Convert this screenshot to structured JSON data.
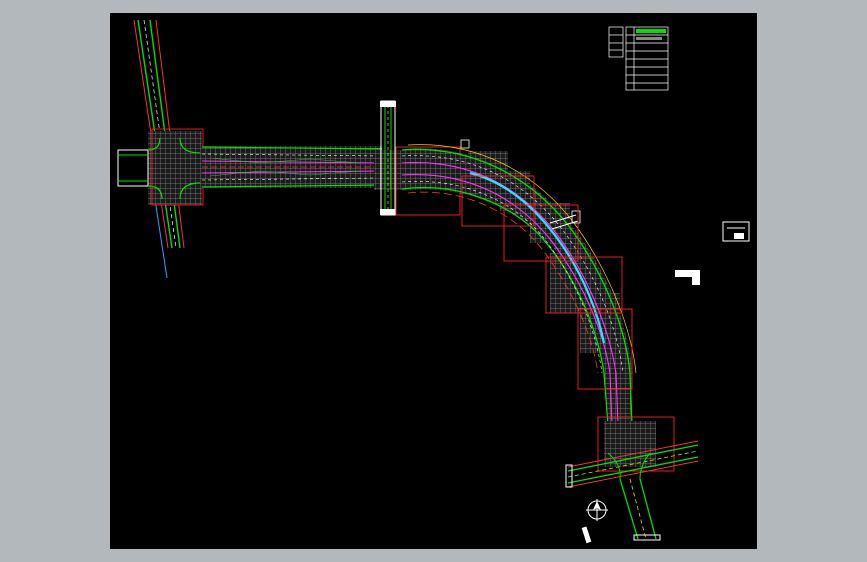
{
  "drawing": {
    "background": "#000000",
    "frame_background": "#b3b8bd",
    "colors": {
      "edge_line": "#00e000",
      "center_line": "#ff3030",
      "lane_mark": "#ffffff",
      "median": "#ff30ff",
      "pavement": "#888888",
      "axis_line": "#30e0ff",
      "sheet_frame": "#ff2020",
      "yellow_mark": "#ffd000"
    },
    "elements": [
      "road-plan",
      "intersection-west",
      "intersection-middle",
      "intersection-south",
      "sheet-index-frames",
      "title-table",
      "north-arrow",
      "legend-block"
    ]
  }
}
